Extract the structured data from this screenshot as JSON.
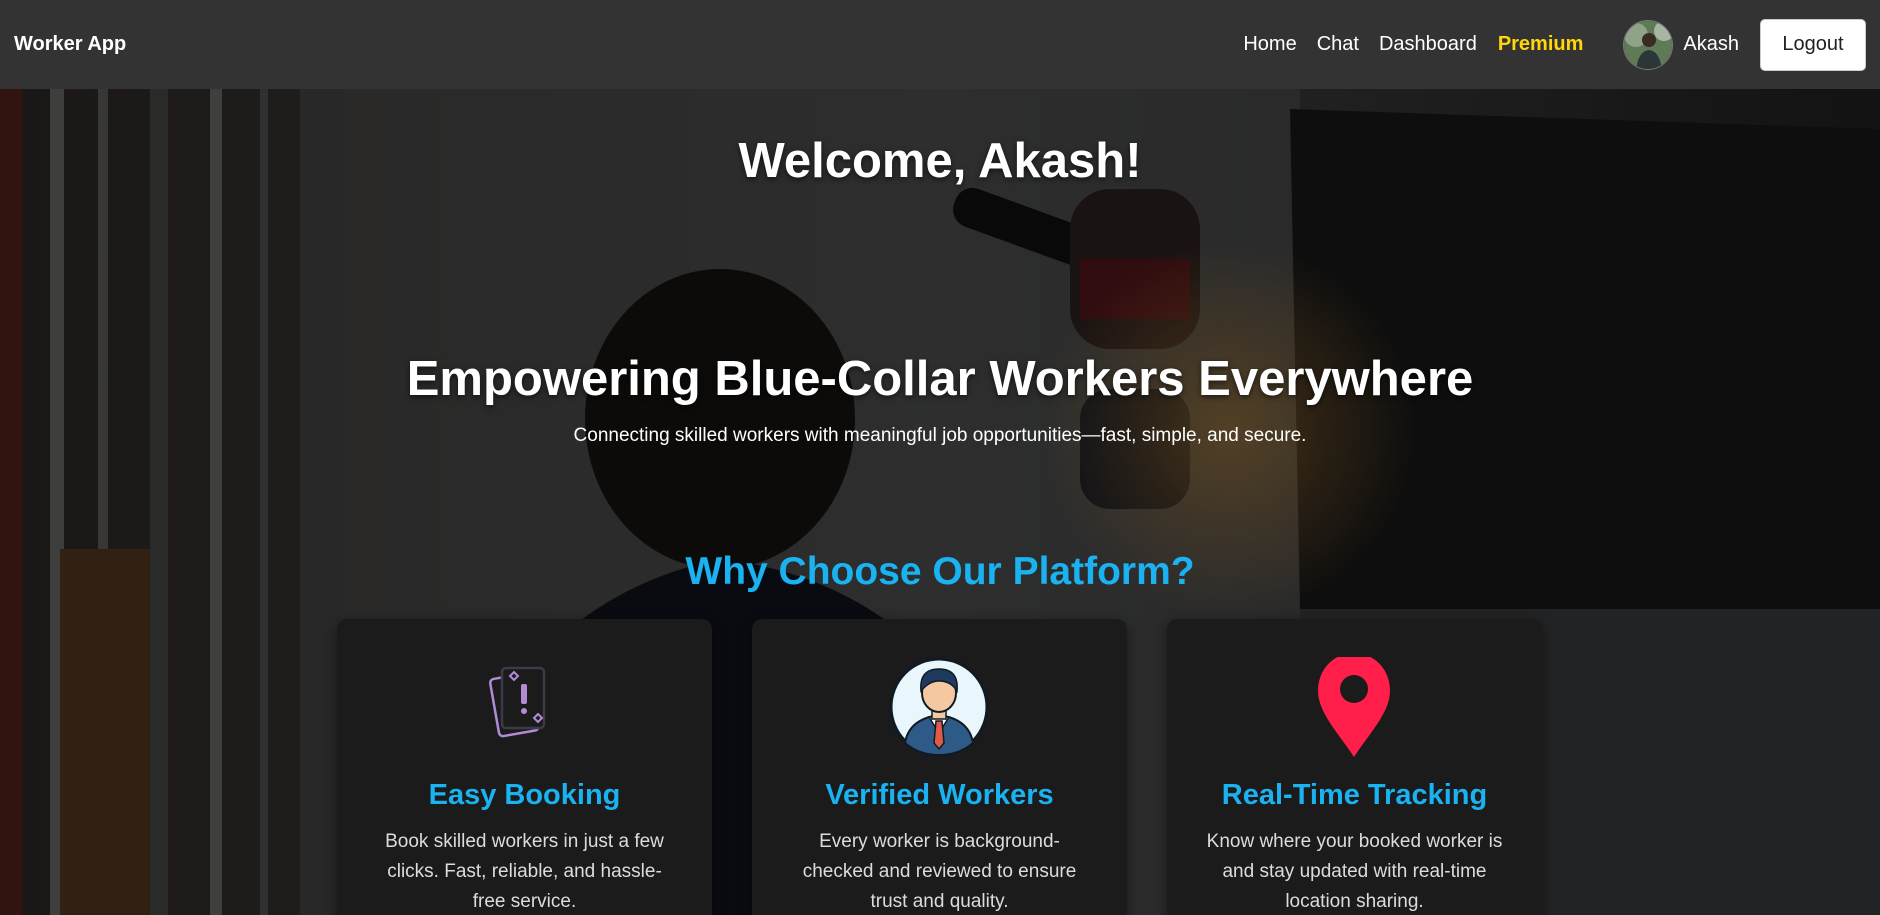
{
  "navbar": {
    "brand": "Worker App",
    "links": [
      "Home",
      "Chat",
      "Dashboard"
    ],
    "premium": "Premium",
    "user_name": "Akash",
    "logout_label": "Logout",
    "premium_color": "#FFD60A"
  },
  "hero": {
    "welcome": "Welcome, Akash!",
    "headline": "Empowering Blue-Collar Workers Everywhere",
    "subline": "Connecting skilled workers with meaningful job opportunities—fast, simple, and secure.",
    "why_title": "Why Choose Our Platform?",
    "accent_color": "#1ab2f0"
  },
  "features": [
    {
      "icon": "cards-icon",
      "title": "Easy Booking",
      "text": "Book skilled workers in just a few clicks. Fast, reliable, and hassle-free service."
    },
    {
      "icon": "businessman-icon",
      "title": "Verified Workers",
      "text": "Every worker is background-checked and reviewed to ensure trust and quality."
    },
    {
      "icon": "location-pin-icon",
      "title": "Real-Time Tracking",
      "text": "Know where your booked worker is and stay updated with real-time location sharing."
    }
  ]
}
